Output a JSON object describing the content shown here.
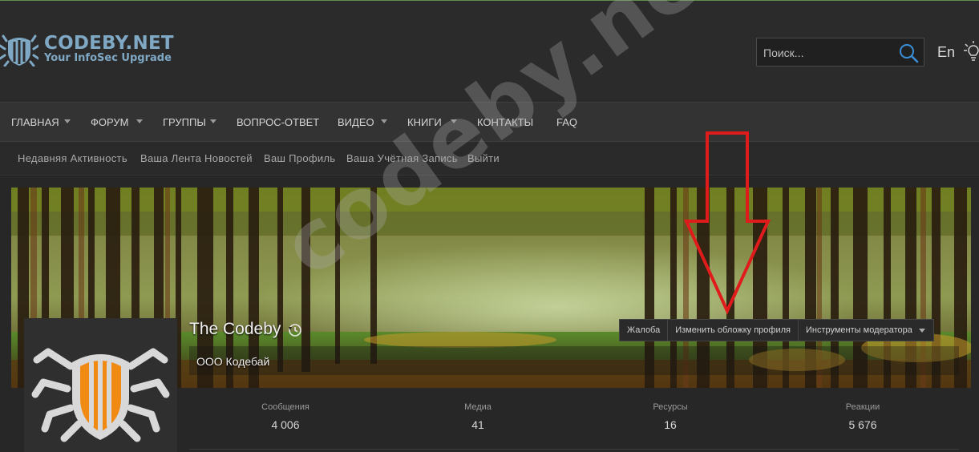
{
  "site": {
    "logo_title": "CODEBY.NET",
    "logo_subtitle": "Your InfoSec Upgrade",
    "brand_color": "#7fa8c4"
  },
  "search": {
    "placeholder": "Поиск..."
  },
  "lang": "En",
  "nav": {
    "items": [
      {
        "label": "ГЛАВНАЯ",
        "dropdown": true
      },
      {
        "label": "ФОРУМ",
        "dropdown": true
      },
      {
        "label": "ГРУППЫ",
        "dropdown": true
      },
      {
        "label": "ВОПРОС-ОТВЕТ",
        "dropdown": false
      },
      {
        "label": "ВИДЕО",
        "dropdown": true
      },
      {
        "label": "КНИГИ",
        "dropdown": true
      },
      {
        "label": "КОНТАКТЫ",
        "dropdown": false
      },
      {
        "label": "FAQ",
        "dropdown": false
      }
    ]
  },
  "subnav": {
    "items": [
      "Недавняя Активность",
      "Ваша Лента Новостей",
      "Ваш Профиль",
      "Ваша Учётная Запись",
      "Выйти"
    ]
  },
  "profile": {
    "username": "The Codeby",
    "user_title": "ООО Кодебай",
    "buttons": {
      "report": "Жалоба",
      "change_cover": "Изменить обложку профиля",
      "moderator_tools": "Инструменты модератора"
    },
    "stats": [
      {
        "label": "Сообщения",
        "value": "4 006"
      },
      {
        "label": "Медиа",
        "value": "41"
      },
      {
        "label": "Ресурсы",
        "value": "16"
      },
      {
        "label": "Реакции",
        "value": "5 676"
      }
    ]
  },
  "watermark": "codeby.net",
  "annotation_color": "#e01b1b",
  "avatar_accent": "#f08a12"
}
